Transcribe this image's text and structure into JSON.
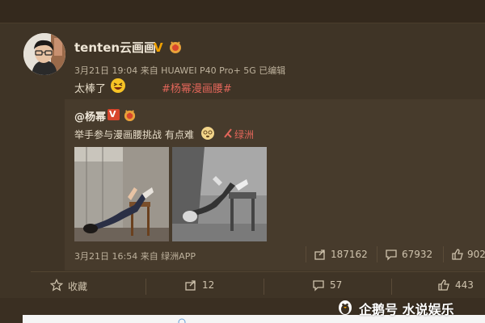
{
  "post": {
    "username": "tenten云画画",
    "verified_badge": "V",
    "meta": "3月21日 19:04 来自 HUAWEI P40 Pro+ 5G  已编辑",
    "text": "太棒了",
    "hashtag": "#杨幂漫画腰#"
  },
  "repost": {
    "username": "@杨幂",
    "verified_badge": "V",
    "text": "举手参与漫画腰挑战 有点难",
    "location_link": "绿洲",
    "meta": "3月21日 16:54 来自 绿洲APP",
    "stats": {
      "forwards": "187162",
      "comments": "67932",
      "likes": "902"
    }
  },
  "actions": {
    "favorite": "收藏",
    "forward": "12",
    "comment": "57",
    "like": "443"
  },
  "watermark": {
    "text": "企鹅号 水说娱乐"
  },
  "colors": {
    "background": "#3a2f22",
    "card": "#3f3426",
    "repost_box": "#473b2c",
    "link": "#e2665a",
    "verified": "#f0a000"
  },
  "icons": {
    "forward": "share-icon",
    "comment": "comment-icon",
    "like": "thumbs-up-icon",
    "favorite": "star-icon"
  }
}
